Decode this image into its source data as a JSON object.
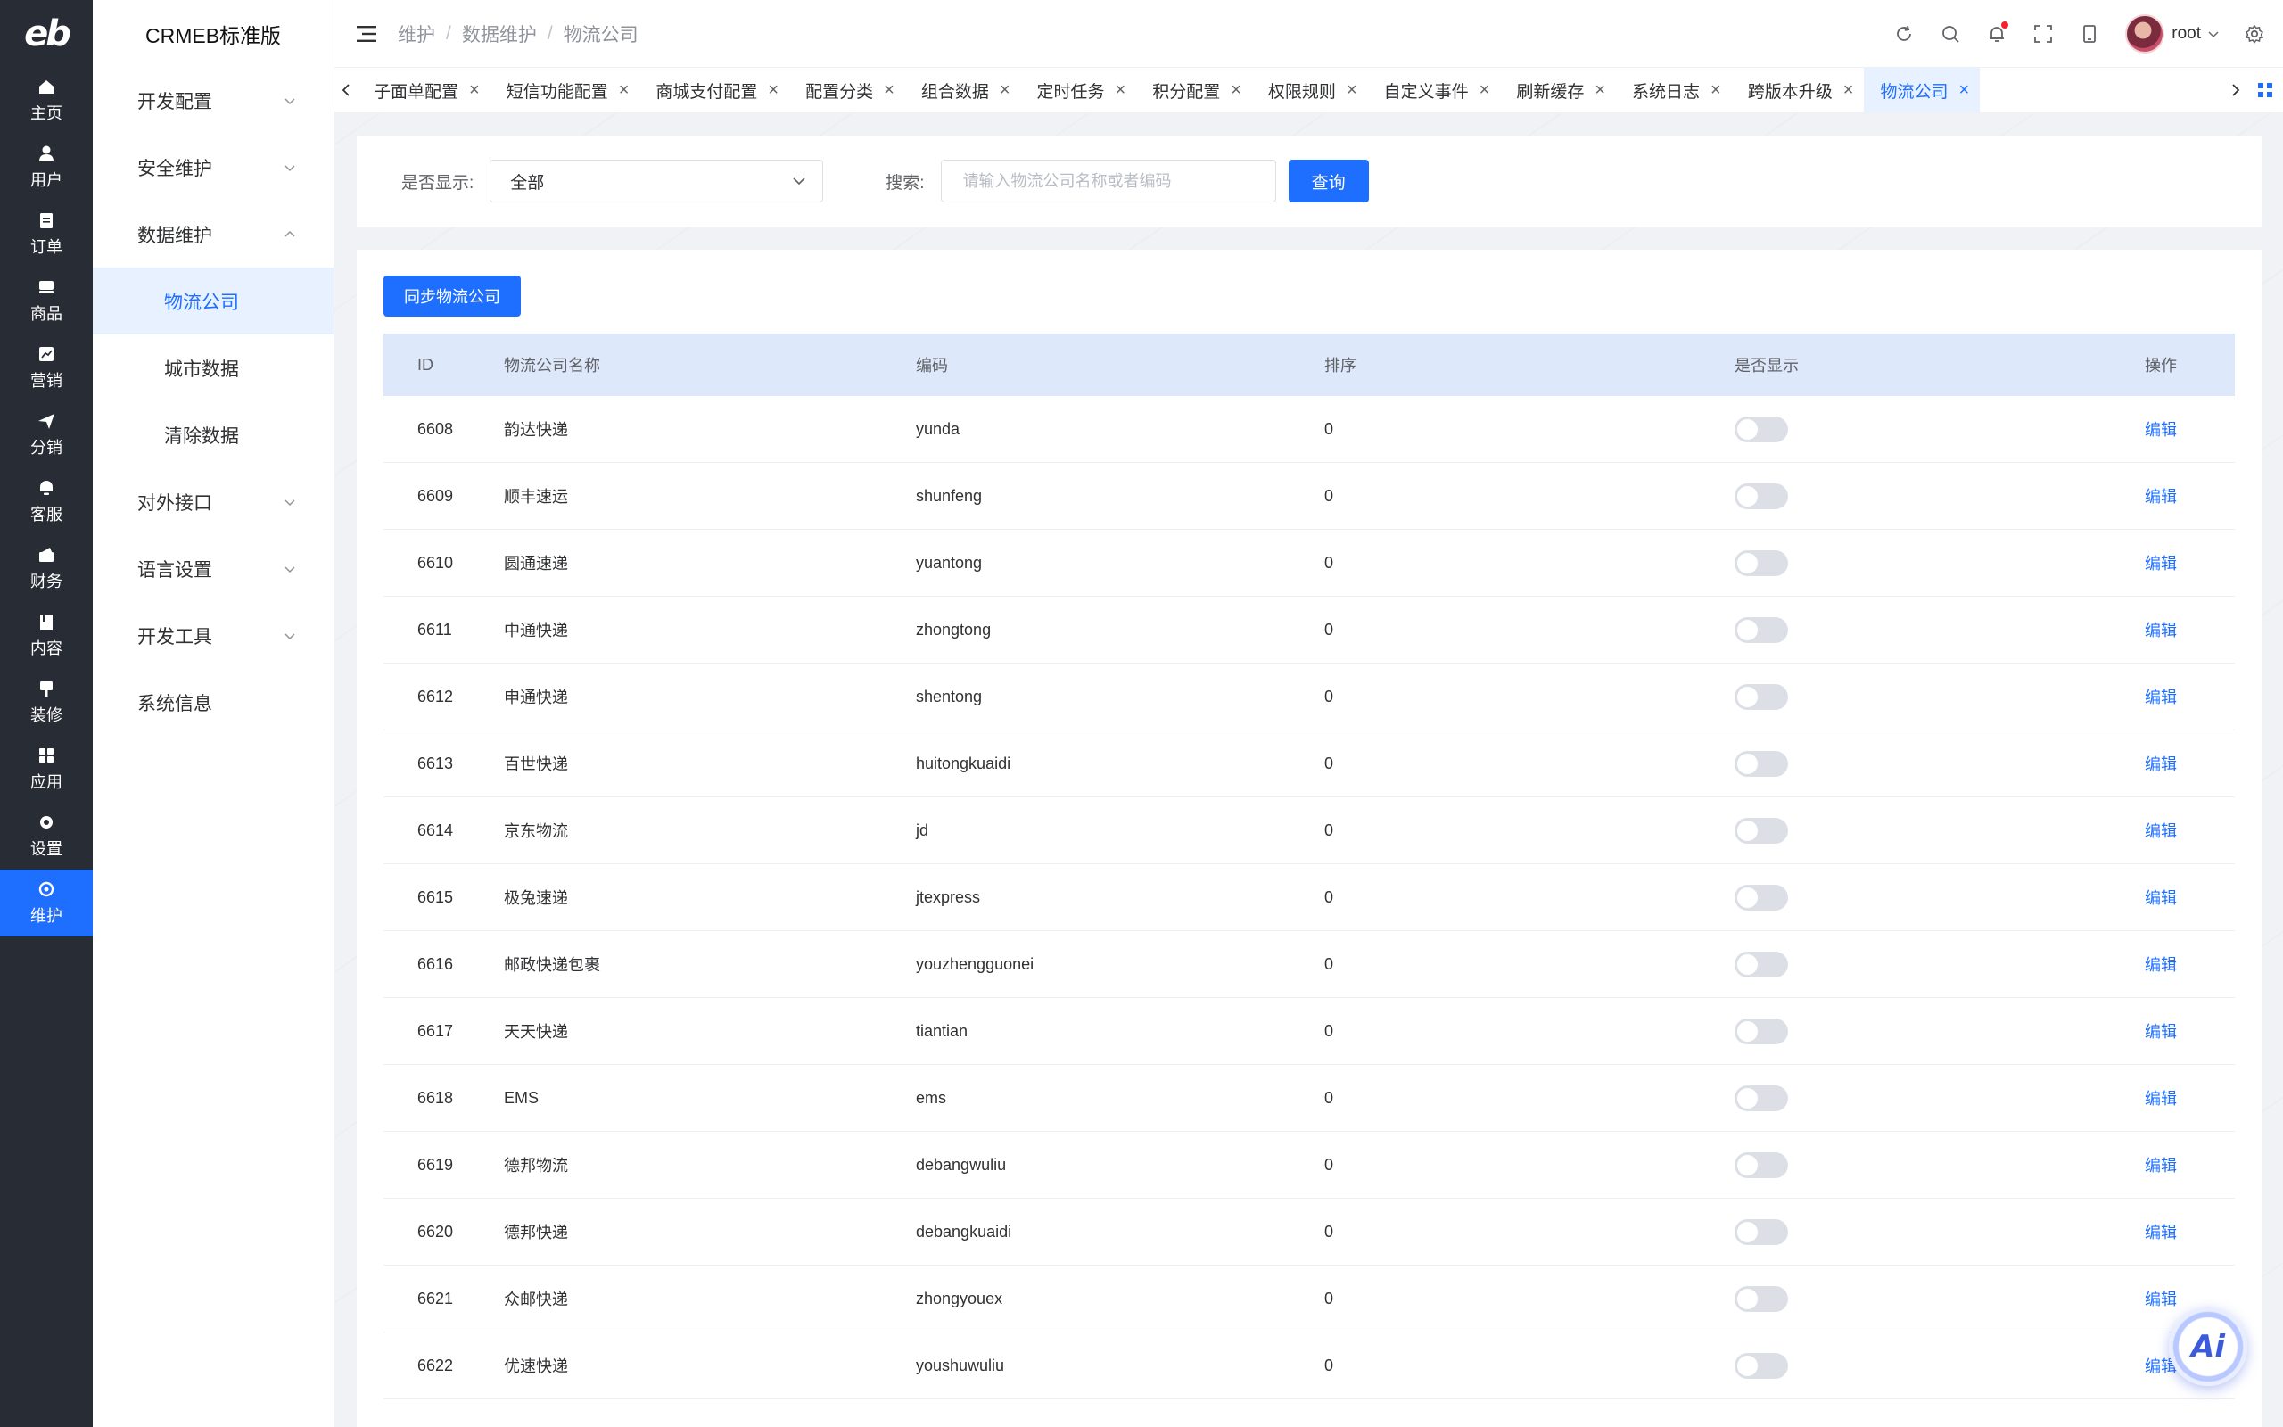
{
  "brand": {
    "logo_text": "eb",
    "app_name": "CRMEB标准版"
  },
  "rail": {
    "items": [
      {
        "label": "主页",
        "icon": "home-icon"
      },
      {
        "label": "用户",
        "icon": "user-icon"
      },
      {
        "label": "订单",
        "icon": "order-icon"
      },
      {
        "label": "商品",
        "icon": "product-icon"
      },
      {
        "label": "营销",
        "icon": "marketing-icon"
      },
      {
        "label": "分销",
        "icon": "distribution-icon"
      },
      {
        "label": "客服",
        "icon": "service-icon"
      },
      {
        "label": "财务",
        "icon": "finance-icon"
      },
      {
        "label": "内容",
        "icon": "content-icon"
      },
      {
        "label": "装修",
        "icon": "decorate-icon"
      },
      {
        "label": "应用",
        "icon": "apps-icon"
      },
      {
        "label": "设置",
        "icon": "settings-icon"
      },
      {
        "label": "维护",
        "icon": "maintain-icon",
        "active": true
      }
    ]
  },
  "submenu": {
    "items": [
      {
        "label": "开发配置"
      },
      {
        "label": "安全维护"
      },
      {
        "label": "数据维护"
      },
      {
        "label": "物流公司"
      },
      {
        "label": "城市数据"
      },
      {
        "label": "清除数据"
      },
      {
        "label": "对外接口"
      },
      {
        "label": "语言设置"
      },
      {
        "label": "开发工具"
      },
      {
        "label": "系统信息"
      }
    ]
  },
  "header": {
    "breadcrumb": [
      "维护",
      "数据维护",
      "物流公司"
    ],
    "separator": "/",
    "username": "root"
  },
  "tabs": {
    "items": [
      {
        "label": "子面单配置"
      },
      {
        "label": "短信功能配置"
      },
      {
        "label": "商城支付配置"
      },
      {
        "label": "配置分类"
      },
      {
        "label": "组合数据"
      },
      {
        "label": "定时任务"
      },
      {
        "label": "积分配置"
      },
      {
        "label": "权限规则"
      },
      {
        "label": "自定义事件"
      },
      {
        "label": "刷新缓存"
      },
      {
        "label": "系统日志"
      },
      {
        "label": "跨版本升级"
      },
      {
        "label": "物流公司"
      }
    ],
    "close_glyph": "×"
  },
  "filter": {
    "show_label": "是否显示:",
    "show_value": "全部",
    "search_label": "搜索:",
    "search_placeholder": "请输入物流公司名称或者编码",
    "search_value": "",
    "query_button": "查询"
  },
  "table": {
    "sync_button": "同步物流公司",
    "columns": [
      "ID",
      "物流公司名称",
      "编码",
      "排序",
      "是否显示",
      "操作"
    ],
    "rows": [
      {
        "id": "6608",
        "name": "韵达快递",
        "code": "yunda",
        "sort": "0",
        "show": false,
        "op": "编辑"
      },
      {
        "id": "6609",
        "name": "顺丰速运",
        "code": "shunfeng",
        "sort": "0",
        "show": false,
        "op": "编辑"
      },
      {
        "id": "6610",
        "name": "圆通速递",
        "code": "yuantong",
        "sort": "0",
        "show": false,
        "op": "编辑"
      },
      {
        "id": "6611",
        "name": "中通快递",
        "code": "zhongtong",
        "sort": "0",
        "show": false,
        "op": "编辑"
      },
      {
        "id": "6612",
        "name": "申通快递",
        "code": "shentong",
        "sort": "0",
        "show": false,
        "op": "编辑"
      },
      {
        "id": "6613",
        "name": "百世快递",
        "code": "huitongkuaidi",
        "sort": "0",
        "show": false,
        "op": "编辑"
      },
      {
        "id": "6614",
        "name": "京东物流",
        "code": "jd",
        "sort": "0",
        "show": false,
        "op": "编辑"
      },
      {
        "id": "6615",
        "name": "极兔速递",
        "code": "jtexpress",
        "sort": "0",
        "show": false,
        "op": "编辑"
      },
      {
        "id": "6616",
        "name": "邮政快递包裹",
        "code": "youzhengguonei",
        "sort": "0",
        "show": false,
        "op": "编辑"
      },
      {
        "id": "6617",
        "name": "天天快递",
        "code": "tiantian",
        "sort": "0",
        "show": false,
        "op": "编辑"
      },
      {
        "id": "6618",
        "name": "EMS",
        "code": "ems",
        "sort": "0",
        "show": false,
        "op": "编辑"
      },
      {
        "id": "6619",
        "name": "德邦物流",
        "code": "debangwuliu",
        "sort": "0",
        "show": false,
        "op": "编辑"
      },
      {
        "id": "6620",
        "name": "德邦快递",
        "code": "debangkuaidi",
        "sort": "0",
        "show": false,
        "op": "编辑"
      },
      {
        "id": "6621",
        "name": "众邮快递",
        "code": "zhongyouex",
        "sort": "0",
        "show": false,
        "op": "编辑"
      },
      {
        "id": "6622",
        "name": "优速快递",
        "code": "youshuwuliu",
        "sort": "0",
        "show": false,
        "op": "编辑"
      }
    ]
  },
  "ai_button": {
    "label": "Ai"
  },
  "colors": {
    "primary": "#1e6fff",
    "rail_bg": "#282c34",
    "table_header_bg": "#dde8fb",
    "switch_off": "#dcdfe6",
    "notification_dot": "#f5222d"
  }
}
